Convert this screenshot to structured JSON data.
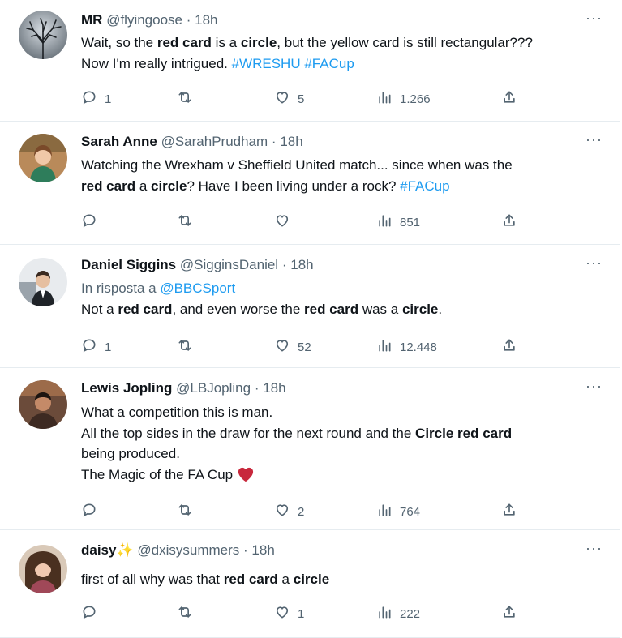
{
  "tweets": [
    {
      "name": "MR",
      "handle": "@flyingoose",
      "sep": "·",
      "time": "18h",
      "avatar": "tree-silhouette-avatar",
      "lines": [
        [
          {
            "t": "Wait, so the "
          },
          {
            "t": "red card",
            "b": true
          },
          {
            "t": " is a "
          },
          {
            "t": "circle",
            "b": true
          },
          {
            "t": ", but the yellow card is still rectangular???"
          }
        ],
        [
          {
            "t": "Now I'm really intrigued. "
          },
          {
            "t": "#WRESHU",
            "h": true
          },
          {
            "t": " "
          },
          {
            "t": "#FACup",
            "h": true
          }
        ]
      ],
      "replies": "1",
      "retweets": "",
      "likes": "5",
      "views": "1.266"
    },
    {
      "name": "Sarah Anne",
      "handle": "@SarahPrudham",
      "sep": "·",
      "time": "18h",
      "avatar": "woman-portrait-avatar",
      "lines": [
        [
          {
            "t": "Watching the Wrexham v Sheffield United match... since when was the"
          }
        ],
        [
          {
            "t": "red card",
            "b": true
          },
          {
            "t": " a "
          },
          {
            "t": "circle",
            "b": true
          },
          {
            "t": "? Have I been living under a rock? "
          },
          {
            "t": "#FACup",
            "h": true
          }
        ]
      ],
      "replies": "",
      "retweets": "",
      "likes": "",
      "views": "851"
    },
    {
      "name": "Daniel Siggins",
      "handle": "@SigginsDaniel",
      "sep": "·",
      "time": "18h",
      "avatar": "man-suit-avatar",
      "reply_to_prefix": "In risposta a ",
      "reply_to_handle": "@BBCSport",
      "lines": [
        [
          {
            "t": "Not a "
          },
          {
            "t": "red card",
            "b": true
          },
          {
            "t": ", and even worse the "
          },
          {
            "t": "red card",
            "b": true
          },
          {
            "t": " was a "
          },
          {
            "t": "circle",
            "b": true
          },
          {
            "t": "."
          }
        ]
      ],
      "replies": "1",
      "retweets": "",
      "likes": "52",
      "views": "12.448"
    },
    {
      "name": "Lewis Jopling",
      "handle": "@LBJopling",
      "sep": "·",
      "time": "18h",
      "avatar": "man-portrait-avatar",
      "lines": [
        [
          {
            "t": "What a competition this is man."
          }
        ],
        [
          {
            "t": "All the top sides in the draw for the next round and the "
          },
          {
            "t": "Circle red card",
            "b": true
          }
        ],
        [
          {
            "t": "being produced."
          }
        ],
        [
          {
            "t": "The Magic of the FA Cup "
          },
          {
            "t": "heart-emoji",
            "heart": true
          }
        ]
      ],
      "replies": "",
      "retweets": "",
      "likes": "2",
      "views": "764"
    },
    {
      "name": "daisy",
      "name_emoji": "✨",
      "handle": "@dxisysummers",
      "sep": "·",
      "time": "18h",
      "avatar": "woman-selfie-avatar",
      "lines": [
        [
          {
            "t": "first of all why was that "
          },
          {
            "t": "red card",
            "b": true
          },
          {
            "t": " a "
          },
          {
            "t": "circle",
            "b": true
          }
        ]
      ],
      "replies": "",
      "retweets": "",
      "likes": "1",
      "views": "222"
    }
  ],
  "more_label": "···",
  "colors": {
    "text": "#0f1419",
    "muted": "#536471",
    "link": "#1d9bf0",
    "border": "#e6ecf0",
    "heart": "#c8283c"
  }
}
